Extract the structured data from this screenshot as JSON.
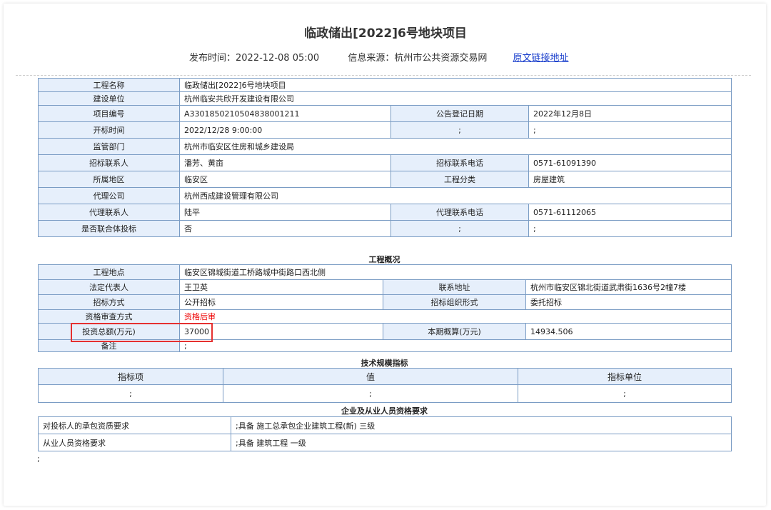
{
  "page": {
    "title": "临政储出[2022]6号地块项目",
    "publish_label": "发布时间：",
    "publish_time": "2022-12-08 05:00",
    "source_label": "信息来源：",
    "source": "杭州市公共资源交易网",
    "link_text": "原文链接地址"
  },
  "basic": {
    "project_name_label": "工程名称",
    "project_name": "临政储出[2022]6号地块项目",
    "builder_label": "建设单位",
    "builder": "杭州临安共欣开发建设有限公司",
    "project_no_label": "项目编号",
    "project_no": "A3301850210504838001211",
    "announce_date_label": "公告登记日期",
    "announce_date": "2022年12月8日",
    "open_time_label": "开标时间",
    "open_time": "2022/12/28 9:00:00",
    "open_extra_label": ";",
    "open_extra": ";",
    "supervisor_label": "监管部门",
    "supervisor": "杭州市临安区住房和城乡建设局",
    "contact_label": "招标联系人",
    "contact": "潘芳、黄亩",
    "contact_phone_label": "招标联系电话",
    "contact_phone": "0571-61091390",
    "region_label": "所属地区",
    "region": "临安区",
    "category_label": "工程分类",
    "category": "房屋建筑",
    "agent_label": "代理公司",
    "agent": "杭州西成建设管理有限公司",
    "agent_contact_label": "代理联系人",
    "agent_contact": "陆平",
    "agent_phone_label": "代理联系电话",
    "agent_phone": "0571-61112065",
    "joint_label": "是否联合体投标",
    "joint": "否",
    "joint_extra_label": ";",
    "joint_extra": ";"
  },
  "overview": {
    "section_title": "工程概况",
    "location_label": "工程地点",
    "location": "临安区锦城街道工桥路城中街路口西北侧",
    "legal_label": "法定代表人",
    "legal": "王卫英",
    "address_label": "联系地址",
    "address": "杭州市临安区锦北街道武肃街1636号2幢7楼",
    "method_label": "招标方式",
    "method": "公开招标",
    "org_form_label": "招标组织形式",
    "org_form": "委托招标",
    "qual_review_label": "资格审查方式",
    "qual_review": "资格后审",
    "investment_label": "投资总额(万元)",
    "investment": "37000",
    "budget_label": "本期概算(万元)",
    "budget": "14934.506",
    "remark_label": "备注",
    "remark": ";"
  },
  "tech": {
    "section_title": "技术规模指标",
    "headers": [
      "指标项",
      "值",
      "指标单位"
    ],
    "row": [
      ";",
      ";",
      ";"
    ]
  },
  "qual": {
    "section_title": "企业及从业人员资格要求",
    "rows": [
      {
        "label": "对投标人的承包资质要求",
        "value": ";具备 施工总承包企业建筑工程(新) 三级"
      },
      {
        "label": "从业人员资格要求",
        "value": ";具备 建筑工程 一级"
      }
    ]
  },
  "tail_text": ";"
}
